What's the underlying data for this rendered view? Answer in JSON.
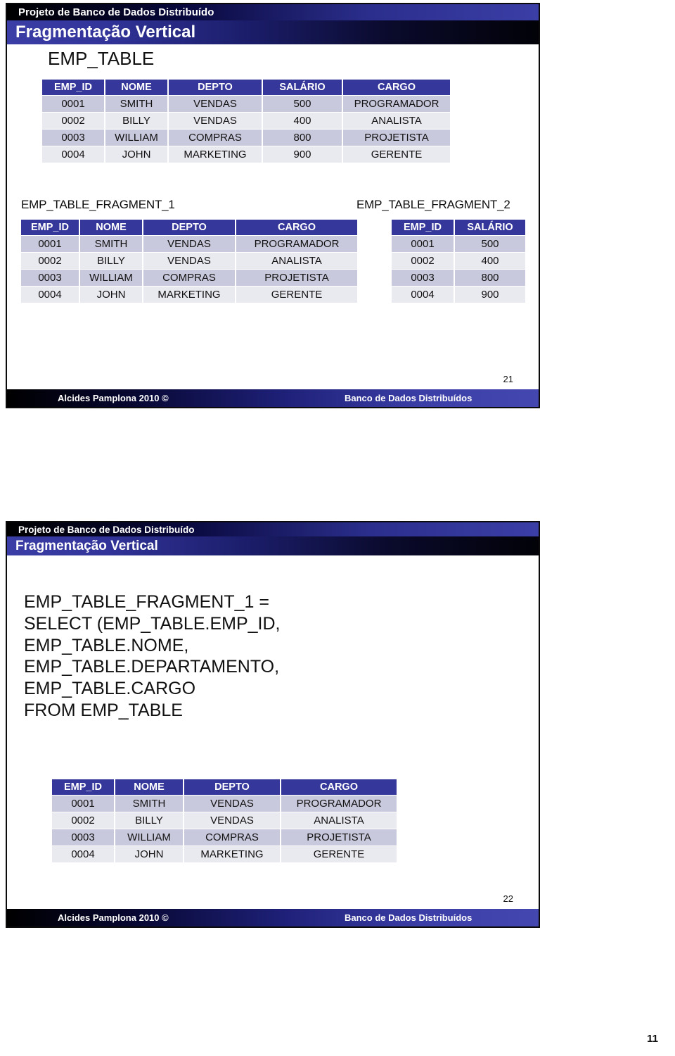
{
  "document": {
    "page_number": "11"
  },
  "slides": [
    {
      "eyebrow": "Projeto de Banco de Dados Distribuído",
      "title": "Fragmentação Vertical",
      "table_caption": "EMP_TABLE",
      "fragment_1_caption": "EMP_TABLE_FRAGMENT_1",
      "fragment_2_caption": "EMP_TABLE_FRAGMENT_2",
      "slide_number": "21",
      "footer_left": "Alcides Pamplona 2010 ©",
      "footer_right": "Banco de Dados Distribuídos",
      "emp_table": {
        "columns": [
          "EMP_ID",
          "NOME",
          "DEPTO",
          "SALÁRIO",
          "CARGO"
        ],
        "rows": [
          [
            "0001",
            "SMITH",
            "VENDAS",
            "500",
            "PROGRAMADOR"
          ],
          [
            "0002",
            "BILLY",
            "VENDAS",
            "400",
            "ANALISTA"
          ],
          [
            "0003",
            "WILLIAM",
            "COMPRAS",
            "800",
            "PROJETISTA"
          ],
          [
            "0004",
            "JOHN",
            "MARKETING",
            "900",
            "GERENTE"
          ]
        ]
      },
      "fragment_1": {
        "columns": [
          "EMP_ID",
          "NOME",
          "DEPTO",
          "CARGO"
        ],
        "rows": [
          [
            "0001",
            "SMITH",
            "VENDAS",
            "PROGRAMADOR"
          ],
          [
            "0002",
            "BILLY",
            "VENDAS",
            "ANALISTA"
          ],
          [
            "0003",
            "WILLIAM",
            "COMPRAS",
            "PROJETISTA"
          ],
          [
            "0004",
            "JOHN",
            "MARKETING",
            "GERENTE"
          ]
        ]
      },
      "fragment_2": {
        "columns": [
          "EMP_ID",
          "SALÁRIO"
        ],
        "rows": [
          [
            "0001",
            "500"
          ],
          [
            "0002",
            "400"
          ],
          [
            "0003",
            "800"
          ],
          [
            "0004",
            "900"
          ]
        ]
      }
    },
    {
      "eyebrow": "Projeto de Banco de Dados Distribuído",
      "title": "Fragmentação Vertical",
      "sql": "EMP_TABLE_FRAGMENT_1 =\nSELECT (EMP_TABLE.EMP_ID,\nEMP_TABLE.NOME,\nEMP_TABLE.DEPARTAMENTO,\nEMP_TABLE.CARGO\nFROM EMP_TABLE",
      "slide_number": "22",
      "footer_left": "Alcides Pamplona 2010 ©",
      "footer_right": "Banco de Dados Distribuídos",
      "result_table": {
        "columns": [
          "EMP_ID",
          "NOME",
          "DEPTO",
          "CARGO"
        ],
        "rows": [
          [
            "0001",
            "SMITH",
            "VENDAS",
            "PROGRAMADOR"
          ],
          [
            "0002",
            "BILLY",
            "VENDAS",
            "ANALISTA"
          ],
          [
            "0003",
            "WILLIAM",
            "COMPRAS",
            "PROJETISTA"
          ],
          [
            "0004",
            "JOHN",
            "MARKETING",
            "GERENTE"
          ]
        ]
      }
    }
  ],
  "colors": {
    "header_blue": "#35379a",
    "bar_dark": "#000000",
    "bar_blue": "#3b3ea6",
    "row_odd": "#c9c9dd",
    "row_even": "#e9e9f0"
  }
}
